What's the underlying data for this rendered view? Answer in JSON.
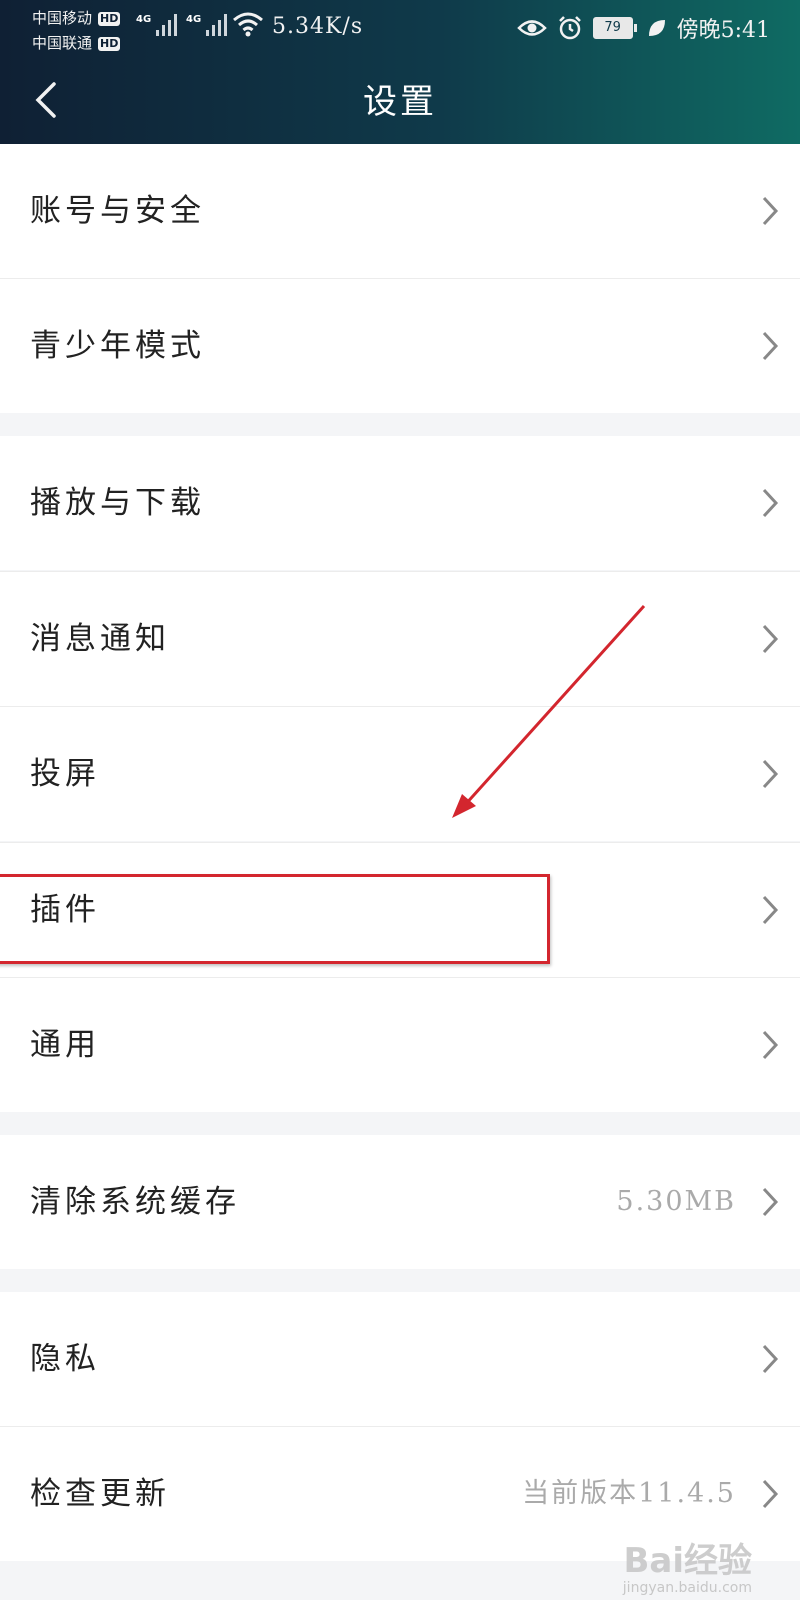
{
  "status_bar": {
    "carrier1": "中国移动",
    "carrier2": "中国联通",
    "hd_badge": "HD",
    "net1": "4G",
    "net2": "4G",
    "speed": "5.34K/s",
    "battery": "79",
    "time": "傍晚5:41"
  },
  "header": {
    "title": "设置"
  },
  "settings": {
    "account_security": "账号与安全",
    "teen_mode": "青少年模式",
    "playback_download": "播放与下载",
    "notifications": "消息通知",
    "screen_cast": "投屏",
    "plugins": "插件",
    "general": "通用",
    "clear_cache": "清除系统缓存",
    "clear_cache_value": "5.30MB",
    "privacy": "隐私",
    "check_update": "检查更新",
    "check_update_value": "当前版本11.4.5"
  },
  "watermark": {
    "text": "Bai经验",
    "sub": "jingyan.baidu.com"
  },
  "colors": {
    "header_start": "#0f2034",
    "header_end": "#0f6b63",
    "annotation": "#d3262e"
  }
}
